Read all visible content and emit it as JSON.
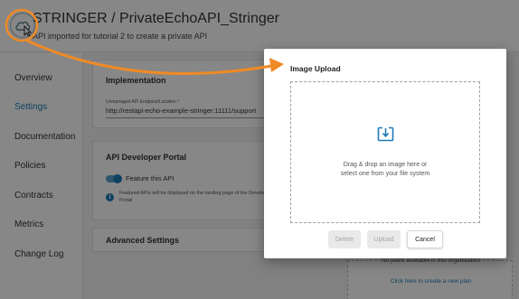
{
  "app": {
    "title": "STRINGER / PrivateEchoAPI_Stringer",
    "subtitle": "API imported for tutorial 2 to create a private API",
    "logo_icon": "cloud-icon"
  },
  "sidebar": {
    "items": [
      {
        "label": "Overview",
        "active": false
      },
      {
        "label": "Settings",
        "active": true
      },
      {
        "label": "Documentation",
        "active": false
      },
      {
        "label": "Policies",
        "active": false
      },
      {
        "label": "Contracts",
        "active": false
      },
      {
        "label": "Metrics",
        "active": false
      },
      {
        "label": "Change Log",
        "active": false
      }
    ]
  },
  "implementation": {
    "title": "Implementation",
    "endpoint_label": "Unmanaged API Endpoint/Location *",
    "endpoint_value": "http://restapi-echo-example-stringer:11111/support"
  },
  "developer_portal": {
    "title": "API Developer Portal",
    "feature_label": "Feature this API",
    "feature_enabled": true,
    "info_text": "Featured APIs will be displayed on the landing page of the Developer Portal"
  },
  "advanced": {
    "title": "Advanced Settings"
  },
  "plans": {
    "empty_text": "No plans available in this organization",
    "create_link": "Click here to create a new plan"
  },
  "modal": {
    "title": "Image Upload",
    "upload_icon": "upload-image-icon",
    "drop_text_line1": "Drag & drop an image here or",
    "drop_text_line2": "select one from your file system",
    "delete_label": "Delete",
    "upload_label": "Upload",
    "cancel_label": "Cancel"
  },
  "colors": {
    "accent": "#1e7bb8",
    "annotation": "#f08a24",
    "overlay": "#000000"
  }
}
